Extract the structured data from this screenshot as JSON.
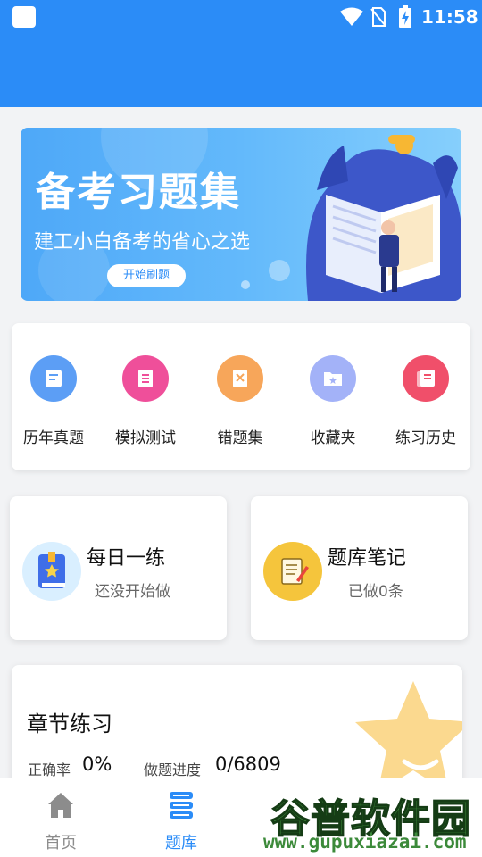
{
  "status_bar": {
    "time": "11:58"
  },
  "banner": {
    "title": "备考习题集",
    "subtitle": "建工小白备考的省心之选",
    "button": "开始刷题"
  },
  "menu": {
    "items": [
      {
        "label": "历年真题",
        "icon": "exam-paper-icon",
        "color": "#5c9ef5"
      },
      {
        "label": "模拟测试",
        "icon": "document-list-icon",
        "color": "#ef4f9a"
      },
      {
        "label": "错题集",
        "icon": "wrong-book-icon",
        "color": "#f7a65a"
      },
      {
        "label": "收藏夹",
        "icon": "star-folder-icon",
        "color": "#a3b2f8"
      },
      {
        "label": "练习历史",
        "icon": "history-stack-icon",
        "color": "#f04f6a"
      }
    ]
  },
  "daily": {
    "title": "每日一练",
    "subtitle": "还没开始做"
  },
  "notes": {
    "title": "题库笔记",
    "subtitle": "已做0条"
  },
  "chapter": {
    "title": "章节练习",
    "accuracy_label": "正确率",
    "accuracy_value": "0%",
    "progress_label": "做题进度",
    "progress_value": "0/6809"
  },
  "bottom_nav": {
    "items": [
      {
        "label": "首页",
        "active": false
      },
      {
        "label": "题库",
        "active": true
      }
    ]
  },
  "watermark": {
    "text": "谷普软件园",
    "url": "www.gupuxiazai.com"
  },
  "colors": {
    "primary": "#2b8cf7",
    "background": "#f2f3f5",
    "inactive_nav": "#8c8c8c"
  }
}
